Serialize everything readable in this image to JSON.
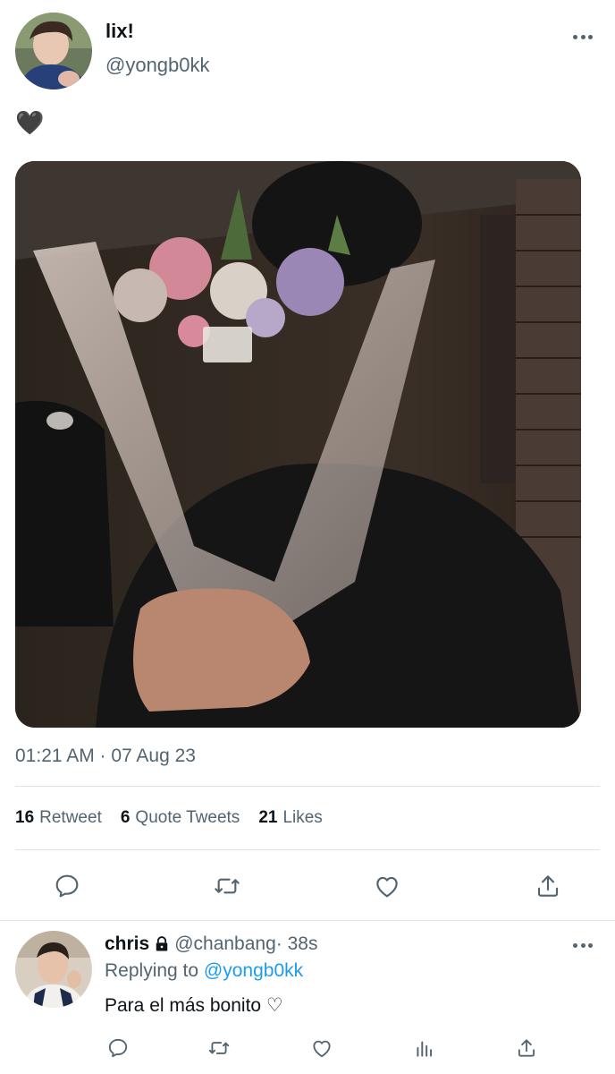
{
  "tweet": {
    "author_name": "lix!",
    "author_handle": "@yongb0kk",
    "text": "🖤",
    "timestamp": "01:21 AM · 07 Aug 23",
    "stats": {
      "retweets_count": "16",
      "retweets_label": "Retweet",
      "quotes_count": "6",
      "quotes_label": "Quote Tweets",
      "likes_count": "21",
      "likes_label": "Likes"
    },
    "actions": [
      "reply-icon",
      "retweet-icon",
      "like-icon",
      "share-icon"
    ]
  },
  "reply": {
    "author_name": "chris",
    "author_handle": "@chanbang",
    "time": " · 38s",
    "replying_prefix": "Replying to ",
    "replying_to": "@yongb0kk",
    "text": "Para el más bonito ♡",
    "actions": [
      "reply-icon",
      "retweet-icon",
      "like-icon",
      "analytics-icon",
      "share-icon"
    ]
  },
  "colors": {
    "primary_text": "#0f1419",
    "secondary_text": "#536471",
    "link": "#1d9bf0",
    "divider": "#dfe3e6"
  }
}
